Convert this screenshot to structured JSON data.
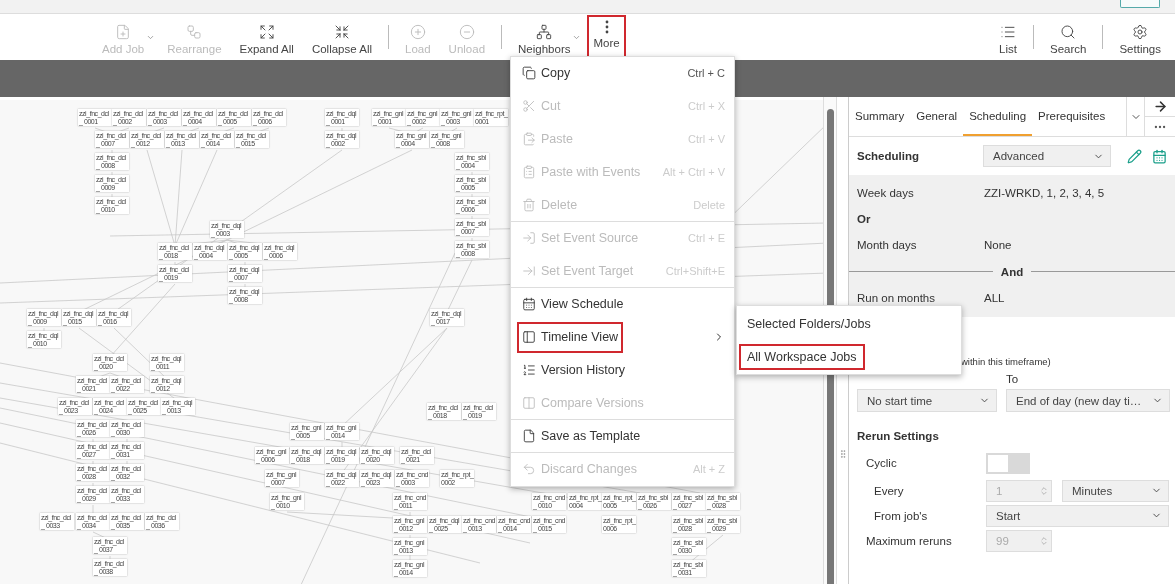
{
  "toolbar": {
    "tools": [
      {
        "label": "Add Job",
        "disabled": true,
        "dropdown": true,
        "highlighted": false
      },
      {
        "label": "Rearrange",
        "disabled": true,
        "dropdown": false,
        "highlighted": false
      },
      {
        "label": "Expand All",
        "disabled": false,
        "dropdown": false,
        "highlighted": false
      },
      {
        "label": "Collapse All",
        "disabled": false,
        "dropdown": false,
        "highlighted": false,
        "divider_after": true
      },
      {
        "label": "Load",
        "disabled": true,
        "dropdown": false,
        "highlighted": false
      },
      {
        "label": "Unload",
        "disabled": true,
        "dropdown": false,
        "highlighted": false,
        "divider_after": true
      },
      {
        "label": "Neighbors",
        "disabled": false,
        "dropdown": true,
        "highlighted": false
      },
      {
        "label": "More",
        "disabled": false,
        "dropdown": false,
        "highlighted": true
      }
    ],
    "right_tools": [
      {
        "label": "List"
      },
      {
        "label": "Search"
      },
      {
        "label": "Settings"
      }
    ]
  },
  "canvas": {
    "nodes": [
      "zzi_fnc_dcl_ 0001",
      "zzi_fnc_dcl_ 0002",
      "zzi_fnc_dcl_ 0003",
      "zzi_fnc_dcl_ 0004",
      "zzi_fnc_dcl_ 0005",
      "zzi_fnc_dcl_ 0006",
      "zzi_fnc_dcl_ 0007",
      "zzi_fnc_dcl_ 0012",
      "zzi_fnc_dcl_ 0013",
      "zzi_fnc_dcl_ 0014",
      "zzi_fnc_dcl_ 0015",
      "zzi_fnc_dcl_ 0008",
      "zzi_fnc_dcl_ 0009",
      "zzi_fnc_dcl_ 0010",
      "zzi_fnc_dql_ 0003",
      "zzi_fnc_dcl_ 0018",
      "zzi_fnc_dql_ 0004",
      "zzi_fnc_dql_ 0005",
      "zzi_fnc_dql_ 0006",
      "zzi_fnc_dcl_ 0019",
      "zzi_fnc_dql_ 0007",
      "zzi_fnc_dql_ 0008",
      "zzi_fnc_dql_ 0009",
      "zzi_fnc_dql_ 0015",
      "zzi_fnc_dql_ 0016",
      "zzi_fnc_dql_ 0010",
      "zzi_fnc_dcl_ 0020",
      "zzi_fnc_dql_ 0011",
      "zzi_fnc_dcl_ 0021",
      "zzi_fnc_dcl_ 0022",
      "zzi_fnc_dql_ 0012",
      "zzi_fnc_dcl_ 0023",
      "zzi_fnc_dcl_ 0024",
      "zzi_fnc_dcl_ 0025",
      "zzi_fnc_dql_ 0013",
      "zzi_fnc_dcl_ 0026",
      "zzi_fnc_dcl_ 0030",
      "zzi_fnc_dcl_ 0027",
      "zzi_fnc_dcl_ 0031",
      "zzi_fnc_dcl_ 0028",
      "zzi_fnc_dcl_ 0032",
      "zzi_fnc_dcl_ 0029",
      "zzi_fnc_dcl_ 0033",
      "zzi_fnc_dcl_ 0033",
      "zzi_fnc_dcl_ 0034",
      "zzi_fnc_dcl_ 0035",
      "zzi_fnc_dcl_ 0036",
      "zzi_fnc_dcl_ 0037",
      "zzi_fnc_dcl_ 0038",
      "zzi_fnc_dql_ 0001",
      "zzi_fnc_dql_ 0002",
      "zzi_fnc_gnl_ 0001",
      "zzi_fnc_gnl_ 0002",
      "zzi_fnc_gnl_ 0003",
      "zzi_fnc_rpt_ 0001",
      "zzi_fnc_gnl_ 0004",
      "zzi_fnc_gnl_ 0008",
      "zzi_fnc_sbl_ 0004",
      "zzi_fnc_sbl_ 0005",
      "zzi_fnc_sbl_ 0006",
      "zzi_fnc_sbl_ 0007",
      "zzi_fnc_sbl_ 0008",
      "zzi_fnc_dql_ 0017",
      "zzi_fnc_dcl_ 0018",
      "zzi_fnc_dcl_ 0019",
      "zzi_fnc_gnl_ 0005",
      "zzi_fnc_gnl_ 0014",
      "zzi_fnc_gnl_ 0006",
      "zzi_fnc_dql_ 0018",
      "zzi_fnc_dql_ 0019",
      "zzi_fnc_dql_ 0020",
      "zzi_fnc_dcl_ 0021",
      "zzi_fnc_gnl_ 0007",
      "zzi_fnc_dql_ 0022",
      "zzi_fnc_dql_ 0023",
      "zzi_fnc_cnd_ 0003",
      "zzi_fnc_rpt_ 0002",
      "zzi_fnc_gnl_ 0010",
      "zzi_fnc_cnd_ 0011",
      "zzi_fnc_cnd_ 0010",
      "zzi_fnc_rpt_ 0004",
      "zzi_fnc_rpt_ 0005",
      "zzi_fnc_sbl_ 0026",
      "zzi_fnc_sbl_ 0027",
      "zzi_fnc_sbl_ 0028",
      "zzi_fnc_gnl_ 0012",
      "zzi_fnc_dql_ 0025",
      "zzi_fnc_cnd_ 0013",
      "zzi_fnc_cnd_ 0014",
      "zzi_fnc_cnd_ 0015",
      "zzi_fnc_rpt_ 0006",
      "zzi_fnc_sbl_ 0028",
      "zzi_fnc_sbl_ 0029",
      "zzi_fnc_gnl_ 0013",
      "zzi_fnc_sbl_ 0030",
      "zzi_fnc_gnl_ 0014",
      "zzi_fnc_sbl_ 0031"
    ]
  },
  "context_menu": [
    {
      "label": "Copy",
      "shortcut": "Ctrl + C",
      "disabled": false,
      "highlighted": false,
      "divider_after": false
    },
    {
      "label": "Cut",
      "shortcut": "Ctrl + X",
      "disabled": true,
      "highlighted": false,
      "divider_after": false
    },
    {
      "label": "Paste",
      "shortcut": "Ctrl + V",
      "disabled": true,
      "highlighted": false,
      "divider_after": false
    },
    {
      "label": "Paste with Events",
      "shortcut": "Alt + Ctrl + V",
      "disabled": true,
      "highlighted": false,
      "divider_after": false
    },
    {
      "label": "Delete",
      "shortcut": "Delete",
      "disabled": true,
      "highlighted": false,
      "divider_after": true
    },
    {
      "label": "Set Event Source",
      "shortcut": "Ctrl + E",
      "disabled": true,
      "highlighted": false,
      "divider_after": false
    },
    {
      "label": "Set Event Target",
      "shortcut": "Ctrl+Shift+E",
      "disabled": true,
      "highlighted": false,
      "divider_after": true
    },
    {
      "label": "View Schedule",
      "disabled": false,
      "highlighted": false,
      "divider_after": false
    },
    {
      "label": "Timeline View",
      "disabled": false,
      "highlighted": true,
      "divider_after": false,
      "submenu": [
        {
          "label": "Selected Folders/Jobs",
          "highlighted": false
        },
        {
          "label": "All Workspace Jobs",
          "highlighted": true
        }
      ]
    },
    {
      "label": "Version History",
      "disabled": false,
      "highlighted": false,
      "divider_after": false
    },
    {
      "label": "Compare Versions",
      "disabled": true,
      "highlighted": false,
      "divider_after": true
    },
    {
      "label": "Save as Template",
      "disabled": false,
      "highlighted": false,
      "divider_after": true
    },
    {
      "label": "Discard Changes",
      "shortcut": "Alt + Z",
      "disabled": true,
      "highlighted": false,
      "divider_after": false
    }
  ],
  "panel": {
    "tabs": [
      {
        "label": "Summary",
        "selected": false
      },
      {
        "label": "General",
        "selected": false
      },
      {
        "label": "Scheduling",
        "selected": true
      },
      {
        "label": "Prerequisites",
        "selected": false
      }
    ],
    "title": "Scheduling",
    "mode": "Advanced",
    "criteria": [
      {
        "kind": "field",
        "label": "Week days",
        "value": "ZZI-WRKD, 1, 2, 3, 4, 5"
      },
      {
        "kind": "connector",
        "label": "Or"
      },
      {
        "kind": "field",
        "label": "Month days",
        "value": "None"
      },
      {
        "kind": "divider",
        "label": "And"
      },
      {
        "kind": "field",
        "label": "Run on months",
        "value": "ALL"
      }
    ],
    "timeframe": {
      "note": "within this timeframe)",
      "to_label": "To",
      "from": "No start time",
      "to": "End of day (new day ti…"
    },
    "rerun": {
      "title": "Rerun Settings",
      "cyclic_label": "Cyclic",
      "cyclic_on": false,
      "every_label": "Every",
      "every_value": "1",
      "every_disabled": true,
      "every_unit": "Minutes",
      "from_label": "From job's",
      "from_value": "Start",
      "max_label": "Maximum reruns",
      "max_value": "99",
      "max_disabled": true
    }
  }
}
